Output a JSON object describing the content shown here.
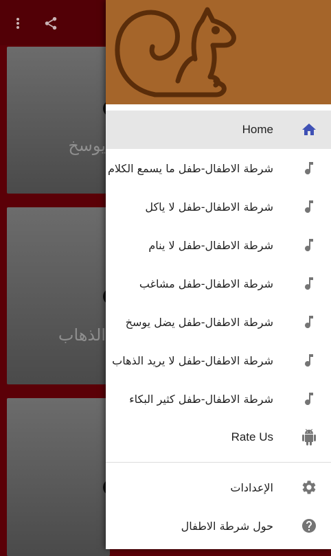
{
  "background": {
    "toolbar": {
      "more_icon": "more-vert-icon",
      "share_icon": "share-icon"
    },
    "cards": [
      {
        "text": "يوسخ"
      },
      {
        "text": "الذهاب"
      },
      {
        "text": ""
      }
    ]
  },
  "drawer": {
    "header": {
      "logo_icon": "squirrel-logo",
      "color": "#a5652a"
    },
    "items": [
      {
        "label": "Home",
        "icon": "home-icon",
        "active": true
      },
      {
        "label": "شرطة الاطفال-طفل ما يسمع الكلام",
        "icon": "music-note-icon"
      },
      {
        "label": "شرطة الاطفال-طفل لا ياكل",
        "icon": "music-note-icon"
      },
      {
        "label": "شرطة الاطفال-طفل لا ينام",
        "icon": "music-note-icon"
      },
      {
        "label": "شرطة الاطفال-طفل مشاغب",
        "icon": "music-note-icon"
      },
      {
        "label": "شرطة الاطفال-طفل يضل يوسخ",
        "icon": "music-note-icon"
      },
      {
        "label": "شرطة الاطفال-طفل لا يريد الذهاب",
        "icon": "music-note-icon"
      },
      {
        "label": "شرطة الاطفال-طفل كثير البكاء",
        "icon": "music-note-icon"
      },
      {
        "label": "Rate Us",
        "icon": "android-icon"
      }
    ],
    "secondary_items": [
      {
        "label": "الإعدادات",
        "icon": "settings-icon"
      },
      {
        "label": "حول شرطة الاطفال",
        "icon": "help-icon"
      }
    ]
  },
  "colors": {
    "accent": "#3f51b5",
    "icon_gray": "#757575",
    "app_primary": "#5b0007"
  }
}
